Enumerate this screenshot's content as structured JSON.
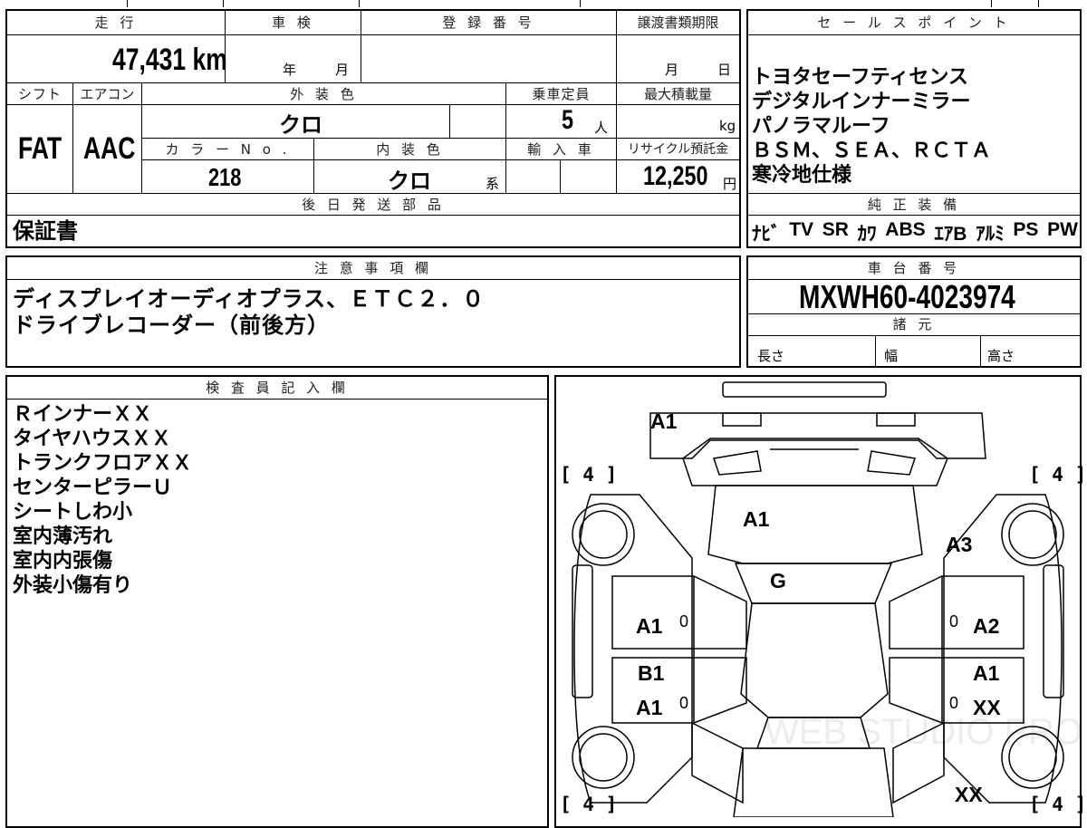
{
  "headers": {
    "mileage": "走 行",
    "inspection": "車 検",
    "registration": "登 録 番 号",
    "transfer_deadline": "譲渡書類期限",
    "sales_points": "セ ー ル ス ポ イ ン ト",
    "shift": "シフト",
    "aircon": "エアコン",
    "exterior_color": "外 装 色",
    "capacity": "乗車定員",
    "max_load": "最大積載量",
    "color_no": "カ ラ ー N o .",
    "interior_color": "内 装 色",
    "import": "輸 入 車",
    "recycle_fee": "リサイクル預託金",
    "later_parts": "後 日 発 送 部 品",
    "genuine_equipment": "純 正 装 備",
    "notes": "注 意 事 項 欄",
    "chassis_number": "車 台 番 号",
    "specs": "諸 元",
    "inspector": "検 査 員 記 入 欄"
  },
  "values": {
    "mileage": "47,431 km",
    "year_unit": "年",
    "month_unit": "月",
    "deadline_month": "月",
    "deadline_day": "日",
    "shift": "FAT",
    "aircon": "AAC",
    "exterior_color": "クロ",
    "capacity": "5",
    "capacity_unit": "人",
    "load_unit": "kg",
    "color_no": "218",
    "interior_color": "クロ",
    "interior_suffix": "系",
    "recycle_fee": "12,250",
    "recycle_unit": "円",
    "later_parts": "保証書",
    "chassis_number": "MXWH60-4023974",
    "length_label": "長さ",
    "width_label": "幅",
    "height_label": "高さ"
  },
  "sales_points": [
    "トヨタセーフティセンス",
    "デジタルインナーミラー",
    "パノラマルーフ",
    "ＢＳＭ、ＳＥＡ、ＲＣＴＡ",
    "寒冷地仕様"
  ],
  "genuine_equipment": [
    "ﾅﾋﾞ",
    "TV",
    "SR",
    "ｶﾜ",
    "ABS",
    "ｴｱB",
    "ｱﾙﾐ",
    "PS",
    "PW"
  ],
  "notes_lines": [
    "ディスプレイオーディオプラス、ＥＴＣ２．０",
    "ドライブレコーダー（前後方）"
  ],
  "inspector_lines": [
    "ＲインナーＸＸ",
    "タイヤハウスＸＸ",
    "トランクフロアＸＸ",
    "センターピラーＵ",
    "シートしわ小",
    "室内薄汚れ",
    "室内内張傷",
    "外装小傷有り"
  ],
  "diagram": {
    "tire_front_left": "4",
    "tire_front_right": "4",
    "tire_rear_left": "4",
    "tire_rear_right": "4",
    "marks": {
      "front_bumper": "A1",
      "hood": "A1",
      "right_front_fender": "A3",
      "windshield": "G",
      "left_front_door": "A1",
      "right_front_door": "A2",
      "left_pillar": "B1",
      "right_pillar": "A1",
      "left_rear_door": "A1",
      "right_rear_door": "XX",
      "right_rear_quarter": "XX",
      "left_front_door_zero": "0",
      "right_front_door_zero": "0",
      "left_rear_door_zero": "0",
      "right_rear_door_zero": "0"
    },
    "watermark": "WEB STUDIO PRO"
  }
}
